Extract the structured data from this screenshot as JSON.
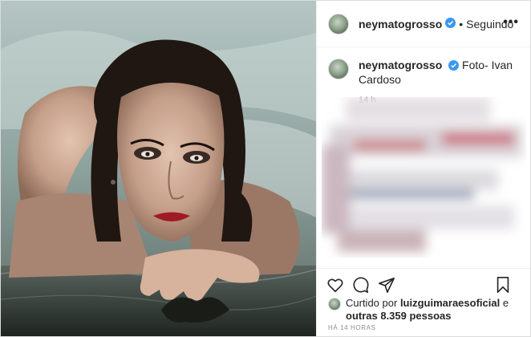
{
  "post": {
    "username": "neymatogrosso",
    "follow_state": "Seguindo",
    "dot": "•",
    "more_label": "•••",
    "caption": {
      "username": "neymatogrosso",
      "text": "Foto- Ivan Cardoso",
      "time": "14 h"
    },
    "likes": {
      "prefix": "Curtido por",
      "user": "luizguimaraesoficial",
      "connector": "e",
      "others": "outras 8.359 pessoas"
    },
    "timestamp": "HÁ 14 HORAS"
  },
  "colors": {
    "verified": "#3897f0",
    "muted": "#8e8e8e",
    "text": "#262626"
  },
  "icons": [
    "heart-icon",
    "comment-icon",
    "share-icon",
    "bookmark-icon",
    "verified-icon",
    "more-icon"
  ]
}
